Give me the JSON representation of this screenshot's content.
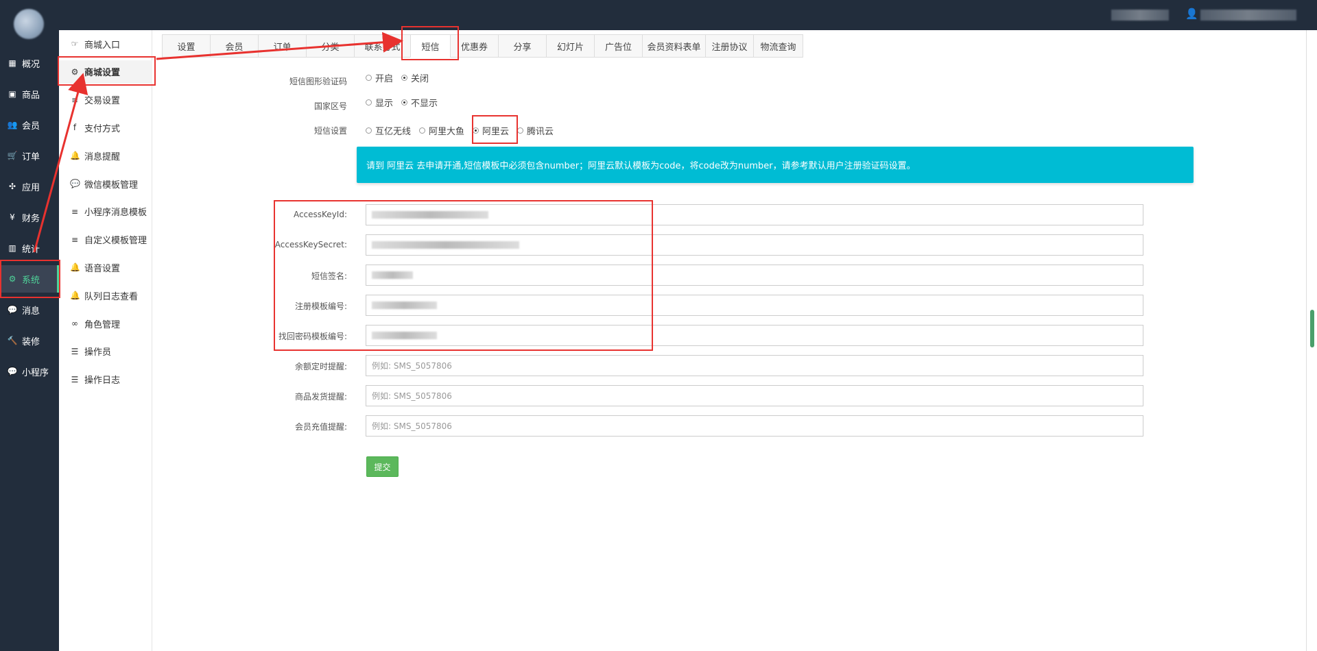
{
  "topbar": {},
  "nav": {
    "items": [
      {
        "label": "概况",
        "icon": "dashboard-icon",
        "glyph": "▦"
      },
      {
        "label": "商品",
        "icon": "goods-icon",
        "glyph": "▣"
      },
      {
        "label": "会员",
        "icon": "users-icon",
        "glyph": "👥"
      },
      {
        "label": "订单",
        "icon": "cart-icon",
        "glyph": "🛒"
      },
      {
        "label": "应用",
        "icon": "apps-icon",
        "glyph": "✣"
      },
      {
        "label": "财务",
        "icon": "yen-icon",
        "glyph": "¥"
      },
      {
        "label": "统计",
        "icon": "bar-chart-icon",
        "glyph": "▥"
      },
      {
        "label": "系统",
        "icon": "cogs-icon",
        "glyph": "⚙"
      },
      {
        "label": "消息",
        "icon": "message-icon",
        "glyph": "💬"
      },
      {
        "label": "装修",
        "icon": "hammer-icon",
        "glyph": "🔨"
      },
      {
        "label": "小程序",
        "icon": "wechat-icon",
        "glyph": "💬"
      }
    ],
    "active_label": "系统"
  },
  "subnav": {
    "items": [
      {
        "label": "商城入口",
        "icon": "hand-pointer-icon",
        "glyph": "☞"
      },
      {
        "label": "商城设置",
        "icon": "gear-icon",
        "glyph": "⚙"
      },
      {
        "label": "交易设置",
        "icon": "list-icon",
        "glyph": "≡"
      },
      {
        "label": "支付方式",
        "icon": "facebook-square-icon",
        "glyph": "f"
      },
      {
        "label": "消息提醒",
        "icon": "bell-icon",
        "glyph": "🔔"
      },
      {
        "label": "微信模板管理",
        "icon": "wechat-icon",
        "glyph": "💬"
      },
      {
        "label": "小程序消息模板",
        "icon": "list-icon",
        "glyph": "≡"
      },
      {
        "label": "自定义模板管理",
        "icon": "list-icon",
        "glyph": "≡"
      },
      {
        "label": "语音设置",
        "icon": "bell-icon",
        "glyph": "🔔"
      },
      {
        "label": "队列日志查看",
        "icon": "bell-icon",
        "glyph": "🔔"
      },
      {
        "label": "角色管理",
        "icon": "link-icon",
        "glyph": "∞"
      },
      {
        "label": "操作员",
        "icon": "list-ul-icon",
        "glyph": "☰"
      },
      {
        "label": "操作日志",
        "icon": "list-ul-icon",
        "glyph": "☰"
      }
    ]
  },
  "tabs": {
    "items": [
      {
        "label": "设置",
        "w": 70
      },
      {
        "label": "会员",
        "w": 70
      },
      {
        "label": "订单",
        "w": 70
      },
      {
        "label": "分类",
        "w": 70
      },
      {
        "label": "联系方式",
        "w": 82
      },
      {
        "label": "短信",
        "w": 58
      },
      {
        "label": "优惠券",
        "w": 70
      },
      {
        "label": "分享",
        "w": 70
      },
      {
        "label": "幻灯片",
        "w": 70
      },
      {
        "label": "广告位",
        "w": 70
      },
      {
        "label": "会员资料表单",
        "w": 92
      },
      {
        "label": "注册协议",
        "w": 70
      },
      {
        "label": "物流查询",
        "w": 73
      }
    ],
    "active_label": "短信"
  },
  "form": {
    "captcha": {
      "label": "短信图形验证码",
      "options": [
        "开启",
        "关闭"
      ],
      "selected": "关闭"
    },
    "country_code": {
      "label": "国家区号",
      "options": [
        "显示",
        "不显示"
      ],
      "selected": "不显示"
    },
    "sms_provider": {
      "label": "短信设置",
      "options": [
        "互亿无线",
        "阿里大鱼",
        "阿里云",
        "腾讯云"
      ],
      "selected": "阿里云"
    },
    "notice": "请到 阿里云 去申请开通,短信模板中必须包含number；阿里云默认模板为code，将code改为number，请参考默认用户注册验证码设置。",
    "fields": [
      {
        "label": "AccessKeyId:",
        "value": "",
        "placeholder": ""
      },
      {
        "label": "AccessKeySecret:",
        "value": "",
        "placeholder": ""
      },
      {
        "label": "短信签名:",
        "value": "",
        "placeholder": ""
      },
      {
        "label": "注册模板编号:",
        "value": "",
        "placeholder": ""
      },
      {
        "label": "找回密码模板编号:",
        "value": "",
        "placeholder": ""
      },
      {
        "label": "余额定时提醒:",
        "value": "",
        "placeholder": "例如: SMS_5057806"
      },
      {
        "label": "商品发货提醒:",
        "value": "",
        "placeholder": "例如: SMS_5057806"
      },
      {
        "label": "会员充值提醒:",
        "value": "",
        "placeholder": "例如: SMS_5057806"
      }
    ],
    "submit_label": "提交"
  },
  "colors": {
    "sidebar_bg": "#222d3c",
    "accent_green": "#4fd49a",
    "notice_bg": "#00bcd4",
    "submit_bg": "#5cb85c",
    "annotation_red": "#e8322f"
  }
}
